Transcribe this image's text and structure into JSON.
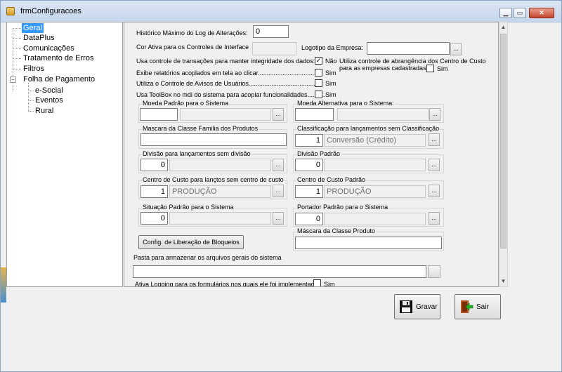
{
  "window": {
    "title": "frmConfiguracoes",
    "restore": "▭",
    "maximize": "□",
    "close": "✕"
  },
  "colors": {
    "selection": "#3399ff",
    "checkmark": "#000000"
  },
  "tree": {
    "items": [
      {
        "label": "Geral",
        "selected": true
      },
      {
        "label": "DataPlus"
      },
      {
        "label": "Comunicações"
      },
      {
        "label": "Tratamento de Erros"
      },
      {
        "label": "Filtros"
      },
      {
        "label": "Folha de Pagamento",
        "expander": "−"
      },
      {
        "label": "e-Social"
      },
      {
        "label": "Eventos"
      },
      {
        "label": "Rural"
      }
    ]
  },
  "form": {
    "historico_label": "Histórico Máximo do Log de Alterações:",
    "historico_value": "0",
    "cor_label": "Cor Ativa para os Controles de Interface",
    "logotipo_label": "Logotipo da Empresa:",
    "dots": "...",
    "transacoes_label": "Usa controle de transações para manter integridade dos dados:",
    "transacoes_check": "✓",
    "nao_label": "Não",
    "abrangencia_label1": "Utiliza controle de abrangência dos Centro de Custo",
    "abrangencia_label2": "para as empresas cadastradas:",
    "sim_label": "Sim",
    "relatorios_label": "Exibe relatórios acoplados em tela ao clicar...................................",
    "avisos_label": "Utiliza o Controle de Avisos de Usuários.......................................",
    "toolbox_label": "Usa ToolBox no mdi do sistema para acoplar funcionalidades..........",
    "moeda_padrao": "Moeda Padrão para o Sistema",
    "moeda_alternativa": "Moeda Alternativa para o Sistema:",
    "mascara_familia": "Mascara da Classe Familia dos Produtos",
    "classificacao": "Classificação para lançamentos sem Classificação",
    "classificacao_code": "1",
    "classificacao_desc": "Conversão (Crédito)",
    "divisao_sem": "Divisão para lançamentos sem divisão",
    "divisao_sem_value": "0",
    "divisao_padrao": "Divisão Padrão",
    "divisao_padrao_value": "0",
    "cc_sem": "Centro de Custo para lançtos sem centro de custo",
    "cc_sem_code": "1",
    "cc_sem_desc": "PRODUÇÃO",
    "cc_padrao": "Centro de Custo Padrão",
    "cc_padrao_code": "1",
    "cc_padrao_desc": "PRODUÇÃO",
    "situacao": "Situação Padrão para o Sistema",
    "situacao_value": "0",
    "portador": "Portador Padrão para o Sistema",
    "portador_value": "0",
    "config_btn": "Config. de Liberação de Bloqueios",
    "mascara_produto": "Máscara da Classe Produto",
    "pasta_label": "Pasta para armazenar os arquivos gerais do sistema",
    "logging_label": "Ativa Logging para os formulários nos quais ele foi implementado:"
  },
  "actions": {
    "gravar": "Gravar",
    "sair": "Sair"
  }
}
